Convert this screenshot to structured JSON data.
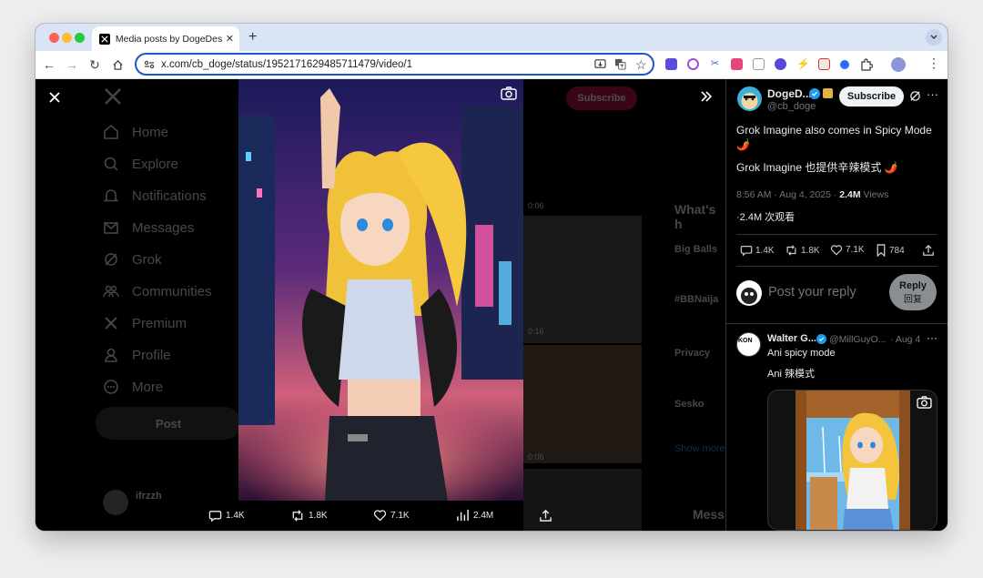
{
  "browser": {
    "tab_title": "Media posts by DogeDesigner",
    "new_tab": "+",
    "url": "x.com/cb_doge/status/1952171629485711479/video/1"
  },
  "background_nav": {
    "items": [
      "Home",
      "Explore",
      "Notifications",
      "Messages",
      "Grok",
      "Communities",
      "Premium",
      "Profile",
      "More"
    ],
    "post_button": "Post",
    "account_name": "ifrzzh"
  },
  "background_timeline": {
    "durations": [
      "0:06",
      "0:16",
      "0:06"
    ],
    "whats_happening": "What's h",
    "trends": [
      "Big Balls",
      "#BBNaija",
      "Privacy",
      "Sesko"
    ],
    "show_more": "Show more",
    "messages": "Mess",
    "subscribe": "Subscribe"
  },
  "media_actions": {
    "replies": "1.4K",
    "reposts": "1.8K",
    "likes": "7.1K",
    "views": "2.4M"
  },
  "post": {
    "author_name": "DogeD...",
    "handle": "@cb_doge",
    "subscribe_label": "Subscribe",
    "text_en": "Grok Imagine also comes in Spicy Mode",
    "emoji": "🌶️",
    "text_zh": "Grok Imagine 也提供辛辣模式 🌶️",
    "timestamp": "8:56 AM · Aug 4, 2025 · ",
    "views_count": "2.4M",
    "views_label": " Views",
    "views_zh": "·2.4M 次观看",
    "stats": {
      "replies": "1.4K",
      "reposts": "1.8K",
      "likes": "7.1K",
      "bookmarks": "784"
    }
  },
  "composer": {
    "placeholder": "Post your reply",
    "reply_label": "Reply",
    "reply_label_zh": "回复"
  },
  "reply": {
    "author_name": "Walter G...",
    "handle": "@MillGuyO...",
    "date": "· Aug 4",
    "text_en": "Ani spicy mode",
    "text_zh": "Ani 辣模式",
    "avatar_text": "KON"
  },
  "colors": {
    "accent": "#1d9bf0",
    "url_focus": "#1a57c7",
    "panel_bg": "#000000"
  }
}
